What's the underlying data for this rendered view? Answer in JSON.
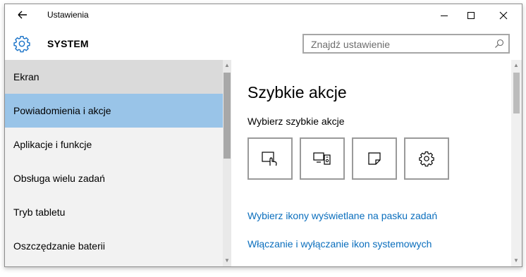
{
  "window": {
    "title": "Ustawienia"
  },
  "header": {
    "section_title": "SYSTEM"
  },
  "search": {
    "placeholder": "Znajdź ustawienie"
  },
  "sidebar": {
    "items": [
      {
        "label": "Ekran",
        "state": "hover"
      },
      {
        "label": "Powiadomienia i akcje",
        "state": "selected"
      },
      {
        "label": "Aplikacje i funkcje",
        "state": "normal"
      },
      {
        "label": "Obsługa wielu zadań",
        "state": "normal"
      },
      {
        "label": "Tryb tabletu",
        "state": "normal"
      },
      {
        "label": "Oszczędzanie baterii",
        "state": "normal"
      }
    ]
  },
  "content": {
    "title": "Szybkie akcje",
    "subtitle": "Wybierz szybkie akcje",
    "quick_actions": [
      {
        "icon": "tablet-mode-icon"
      },
      {
        "icon": "project-icon"
      },
      {
        "icon": "note-icon"
      },
      {
        "icon": "settings-gear-icon"
      }
    ],
    "links": [
      "Wybierz ikony wyświetlane na pasku zadań",
      "Włączanie i wyłączanie ikon systemowych"
    ]
  },
  "colors": {
    "accent": "#0a6ebd",
    "selected_bg": "#99c4e8",
    "hover_bg": "#dadada",
    "sidebar_bg": "#f2f2f2"
  }
}
